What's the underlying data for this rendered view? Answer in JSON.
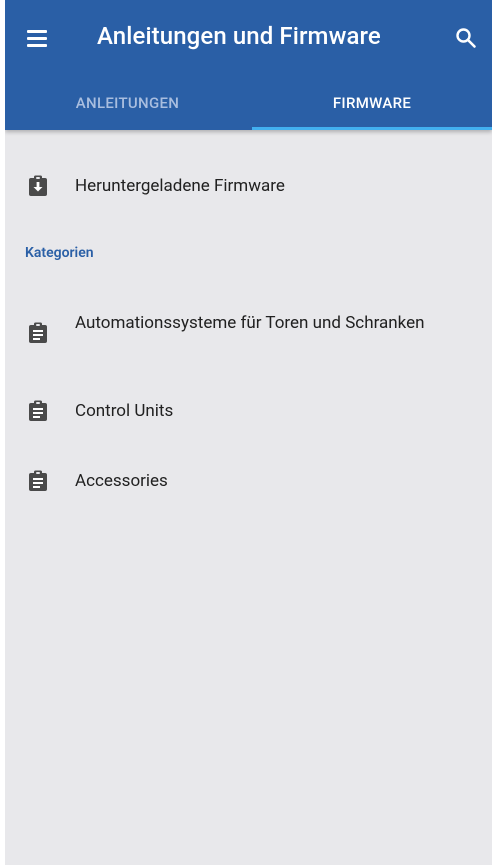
{
  "appbar": {
    "title": "Anleitungen und Firmware",
    "color": "#2a5fa6"
  },
  "tabs": [
    {
      "label": "ANLEITUNGEN",
      "selected": false
    },
    {
      "label": "FIRMWARE",
      "selected": true
    }
  ],
  "downloaded": {
    "label": "Heruntergeladene Firmware",
    "icon": "clipboard-download-icon"
  },
  "section": {
    "title": "Kategorien"
  },
  "categories": [
    {
      "label": "Automationssysteme für Toren und Schranken",
      "icon": "clipboard-list-icon"
    },
    {
      "label": "Control Units",
      "icon": "clipboard-list-icon"
    },
    {
      "label": "Accessories",
      "icon": "clipboard-list-icon"
    }
  ],
  "colors": {
    "accent": "#2a5fa6",
    "indicator": "#42b0f0",
    "background": "#e8e8eb",
    "icon": "#4a4a4a"
  }
}
